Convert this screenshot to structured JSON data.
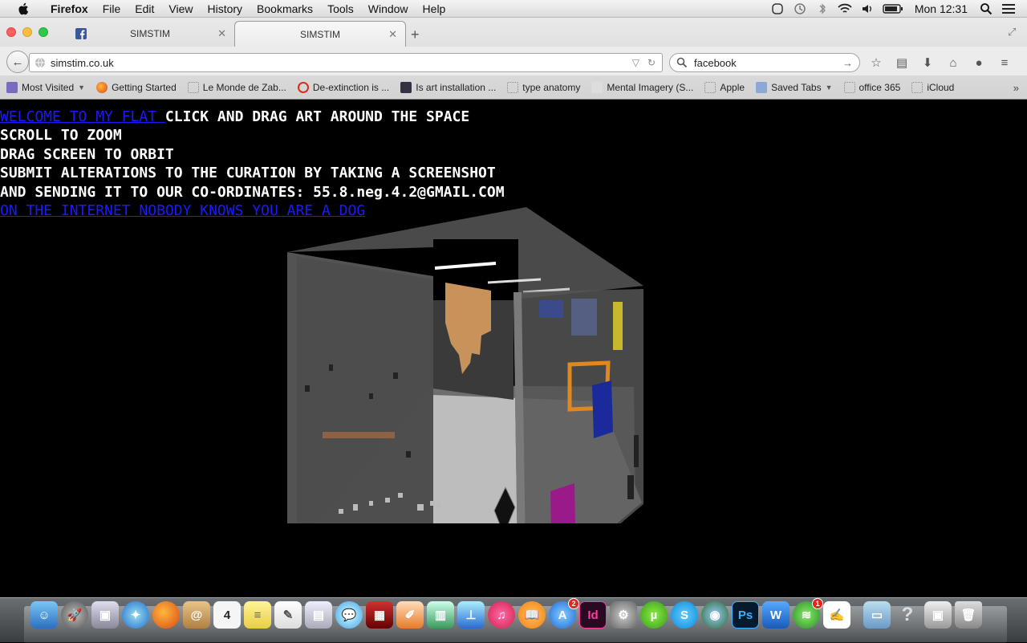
{
  "menubar": {
    "app_name": "Firefox",
    "menus": [
      "File",
      "Edit",
      "View",
      "History",
      "Bookmarks",
      "Tools",
      "Window",
      "Help"
    ],
    "clock": "Mon 12:31"
  },
  "tabs": [
    {
      "title": "SIMSTIM",
      "active": false
    },
    {
      "title": "SIMSTIM",
      "active": true
    }
  ],
  "navbar": {
    "url": "simstim.co.uk",
    "search_value": "facebook"
  },
  "bookmarks": [
    "Most Visited",
    "Getting Started",
    "Le Monde de Zab...",
    "De-extinction is ...",
    "Is art installation ...",
    "type anatomy",
    "Mental Imagery (S...",
    "Apple",
    "Saved Tabs",
    "office 365",
    "iCloud"
  ],
  "page": {
    "welcome_link": "WELCOME TO MY FLAT ",
    "line1_rest": "CLICK AND DRAG ART AROUND THE SPACE",
    "line2": "SCROLL TO ZOOM",
    "line3": "DRAG SCREEN TO ORBIT",
    "line4": "SUBMIT ALTERATIONS TO THE CURATION BY TAKING A SCREENSHOT",
    "line5": "AND SENDING IT TO OUR CO-ORDINATES: 55.8.neg.4.2@GMAIL.COM",
    "dog_link": "ON THE INTERNET NOBODY KNOWS YOU ARE A DOG"
  },
  "dock": {
    "icons": [
      "finder",
      "launchpad",
      "preview",
      "safari",
      "firefox",
      "contacts",
      "calendar",
      "notes",
      "textedit",
      "preview-2",
      "messages",
      "photo-booth",
      "pages",
      "numbers",
      "keynote",
      "itunes",
      "ibooks",
      "app-store",
      "indesign",
      "system-preferences",
      "utorrent",
      "skype",
      "network",
      "photoshop",
      "word",
      "spotify",
      "acrobat",
      "folder",
      "help",
      "dashboard",
      "trash"
    ],
    "calendar_day": "4",
    "app_store_badge": "2",
    "spotify_badge": "1",
    "indesign_label": "Id",
    "photoshop_label": "Ps"
  }
}
